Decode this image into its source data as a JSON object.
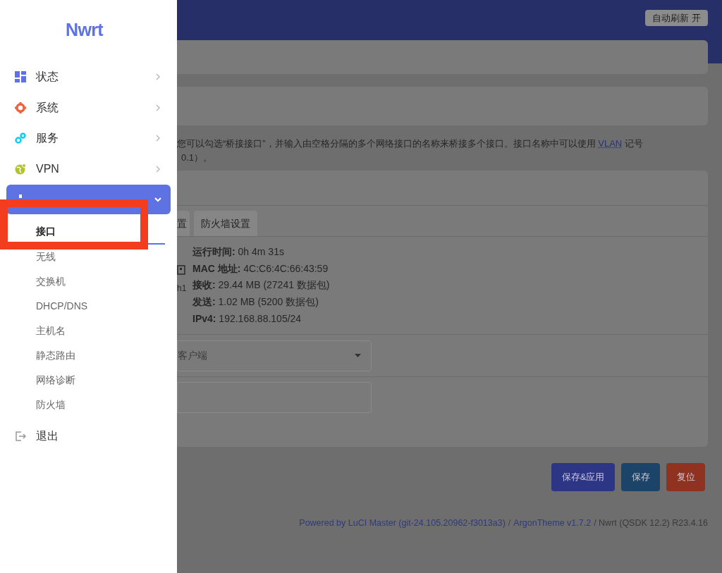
{
  "sidebar": {
    "logo": "Nwrt",
    "items": [
      {
        "label": "状态",
        "kind": "menu",
        "expanded": false
      },
      {
        "label": "系统",
        "kind": "menu",
        "expanded": false
      },
      {
        "label": "服务",
        "kind": "menu",
        "expanded": false
      },
      {
        "label": "VPN",
        "kind": "menu",
        "expanded": false
      },
      {
        "kind": "menu",
        "expanded": true,
        "children": [
          {
            "label": "接口",
            "selected": true
          },
          {
            "label": "无线",
            "selected": false
          },
          {
            "label": "交换机",
            "selected": false
          },
          {
            "label": "DHCP/DNS",
            "selected": false
          },
          {
            "label": "主机名",
            "selected": false
          },
          {
            "label": "静态路由",
            "selected": false
          },
          {
            "label": "网络诊断",
            "selected": false
          },
          {
            "label": "防火墙",
            "selected": false
          }
        ]
      },
      {
        "label": "退出",
        "kind": "link",
        "expanded": false
      }
    ]
  },
  "header": {
    "auto_refresh_button": "自动刷新 开"
  },
  "description": {
    "line_1_before": "您可以勾选“桥接接口”，并输入由空格分隔的多个网络接口的名称来桥接多个接口。接口名称中可以使用",
    "link": "VLAN",
    "line_1_after": "记号",
    "line_2": "0.1）。"
  },
  "tabs": [
    {
      "label": "置"
    },
    {
      "label": "防火墙设置"
    }
  ],
  "status": {
    "device_label": "h1",
    "lines": [
      {
        "label": "运行时间:",
        "value": "0h 4m 31s"
      },
      {
        "label": "MAC 地址:",
        "value": "4C:C6:4C:66:43:59"
      },
      {
        "label": "接收:",
        "value": "29.44 MB (27241 数据包)"
      },
      {
        "label": "发送:",
        "value": "1.02 MB (5200 数据包)"
      },
      {
        "label": "IPv4:",
        "value": "192.168.88.105/24"
      }
    ]
  },
  "protocol_select": {
    "value": "客户端"
  },
  "buttons": [
    {
      "label": "保存&应用",
      "kind": "apply"
    },
    {
      "label": "保存",
      "kind": "save"
    },
    {
      "label": "复位",
      "kind": "reset"
    }
  ],
  "footer": {
    "luci_link": "Powered by LuCI Master (git-24.105.20962-f3013a3)",
    "sep": "/",
    "theme_link": "ArgonTheme v1.7.2",
    "version": "/ Nwrt (QSDK 12.2) R23.4.16"
  }
}
